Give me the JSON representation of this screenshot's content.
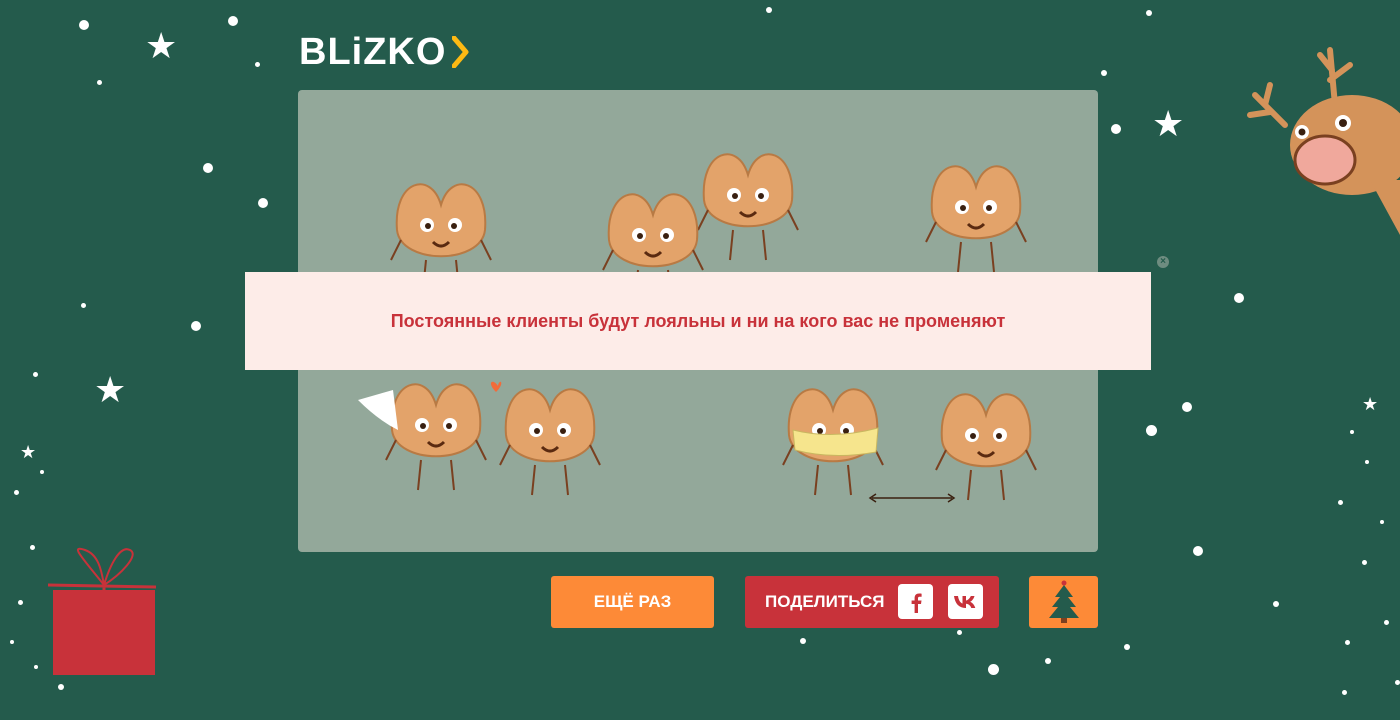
{
  "brand": {
    "name": "BLiZKO"
  },
  "message": {
    "text": "Постоянные клиенты будут лояльны и ни на кого вас не променяют"
  },
  "actions": {
    "again_label": "ЕЩЁ РАЗ",
    "share_label": "ПОДЕЛИТЬСЯ",
    "facebook_icon": "facebook-icon",
    "vk_icon": "vk-icon",
    "tree_icon": "christmas-tree-icon"
  },
  "colors": {
    "background": "#245b4c",
    "card": "#93a89a",
    "banner": "#fdece8",
    "banner_text": "#c8323a",
    "orange": "#fd8a37",
    "red": "#c8323a"
  }
}
